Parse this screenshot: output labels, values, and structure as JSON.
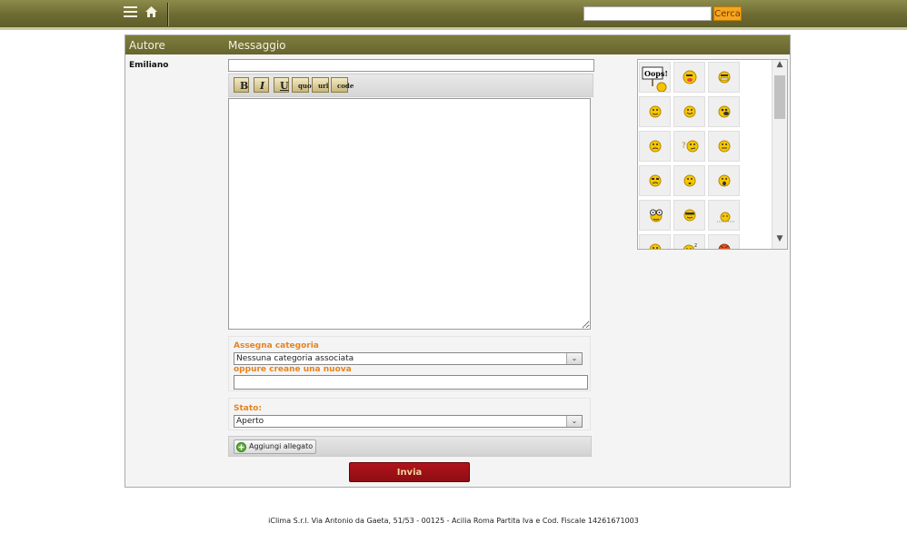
{
  "header": {
    "menu_icon": "hamburger-menu-icon",
    "home_icon": "home-icon",
    "search": {
      "value": "",
      "placeholder": "",
      "button_label": "Cerca"
    },
    "colors": {
      "bar": "#6d6b33",
      "search_button": "#f7a51f"
    }
  },
  "panel": {
    "columns": {
      "author": "Autore",
      "message": "Messaggio"
    },
    "author_name": "Emiliano",
    "subject_value": "",
    "toolbar": {
      "bold": "B",
      "italic": "I",
      "underline": "U",
      "quote": "quote",
      "url": "url",
      "code": "code"
    },
    "message_value": "",
    "emoticons": [
      "oops-sign-icon",
      "tongue-out-smiley-icon",
      "grin-smiley-icon",
      "smile-icon",
      "happy-smiley-icon",
      "laughing-smiley-icon",
      "sad-smiley-icon",
      "thinking-smiley-icon",
      "neutral-smiley-icon",
      "worried-smiley-icon",
      "confused-smiley-icon",
      "surprised-smiley-icon",
      "goggle-eyes-smiley-icon",
      "cool-smiley-icon",
      "drooling-smiley-icon",
      "embarrassed-smiley-icon",
      "sleeping-smiley-icon",
      "angry-smiley-icon"
    ],
    "category": {
      "label": "Assegna categoria",
      "selected": "Nessuna categoria associata",
      "new_label": "oppure creane una nuova",
      "new_value": ""
    },
    "state": {
      "label": "Stato:",
      "selected": "Aperto"
    },
    "attach_label": "Aggiungi allegato",
    "submit_label": "Invia",
    "colors": {
      "header": "#7f7d3d",
      "label": "#e8831c",
      "submit": "#a3111a"
    }
  },
  "footer": {
    "text": "iClima S.r.l. Via Antonio da Gaeta, 51/53 - 00125 - Acilia Roma Partita Iva e Cod. Fiscale 14261671003"
  }
}
